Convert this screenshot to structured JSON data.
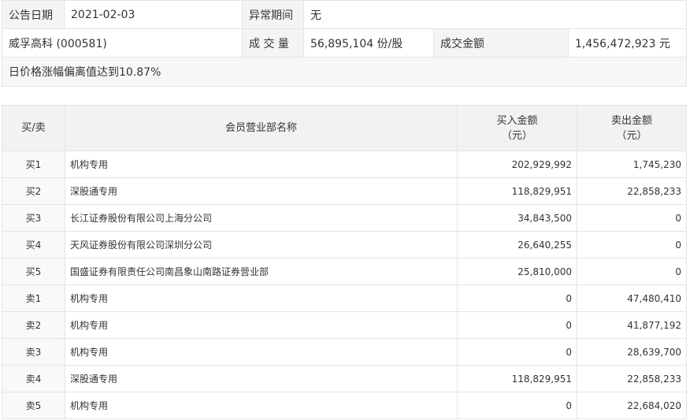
{
  "info": {
    "announce_date_label": "公告日期",
    "announce_date": "2021-02-03",
    "abnormal_period_label": "异常期间",
    "abnormal_period": "无",
    "stock_name": "威孚高科 (000581)",
    "volume_label": "成 交 量",
    "volume": "56,895,104 份/股",
    "amount_label": "成交金额",
    "amount": "1,456,472,923 元",
    "reason": "日价格涨幅偏离值达到10.87%"
  },
  "table": {
    "headers": {
      "side": "买/卖",
      "branch": "会员营业部名称",
      "buy_amount_line1": "买入金额",
      "buy_amount_line2": "（元）",
      "sell_amount_line1": "卖出金额",
      "sell_amount_line2": "（元）"
    },
    "rows": [
      {
        "side": "买1",
        "branch": "机构专用",
        "buy": "202,929,992",
        "sell": "1,745,230"
      },
      {
        "side": "买2",
        "branch": "深股通专用",
        "buy": "118,829,951",
        "sell": "22,858,233"
      },
      {
        "side": "买3",
        "branch": "长江证券股份有限公司上海分公司",
        "buy": "34,843,500",
        "sell": "0"
      },
      {
        "side": "买4",
        "branch": "天风证券股份有限公司深圳分公司",
        "buy": "26,640,255",
        "sell": "0"
      },
      {
        "side": "买5",
        "branch": "国盛证券有限责任公司南昌象山南路证券营业部",
        "buy": "25,810,000",
        "sell": "0"
      },
      {
        "side": "卖1",
        "branch": "机构专用",
        "buy": "0",
        "sell": "47,480,410"
      },
      {
        "side": "卖2",
        "branch": "机构专用",
        "buy": "0",
        "sell": "41,877,192"
      },
      {
        "side": "卖3",
        "branch": "机构专用",
        "buy": "0",
        "sell": "28,639,700"
      },
      {
        "side": "卖4",
        "branch": "深股通专用",
        "buy": "118,829,951",
        "sell": "22,858,233"
      },
      {
        "side": "卖5",
        "branch": "机构专用",
        "buy": "0",
        "sell": "22,684,020"
      }
    ]
  }
}
